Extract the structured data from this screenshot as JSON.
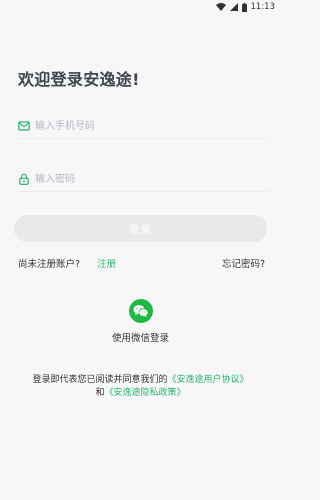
{
  "status_bar": {
    "time": "11:13"
  },
  "title": "欢迎登录安逸途!",
  "phone_field": {
    "placeholder": "输入手机号码"
  },
  "password_field": {
    "placeholder": "输入密码"
  },
  "login_button": "登录",
  "no_account_text": "尚未注册账户?",
  "register_link": "注册",
  "forgot_password": "忘记密码?",
  "wechat_login": "使用微信登录",
  "agreement": {
    "prefix": "登录即代表您已阅读并同意我们的",
    "user_agreement": "《安逸途用户协议》",
    "conjunction": "和",
    "privacy_policy": "《安逸途隐私政策》"
  },
  "colors": {
    "accent": "#28b46b",
    "wechat": "#1fba43",
    "button_disabled": "#e9e9ec"
  },
  "icons": [
    "wifi-icon",
    "signal-icon",
    "battery-icon",
    "mail-icon",
    "lock-icon",
    "wechat-icon"
  ]
}
